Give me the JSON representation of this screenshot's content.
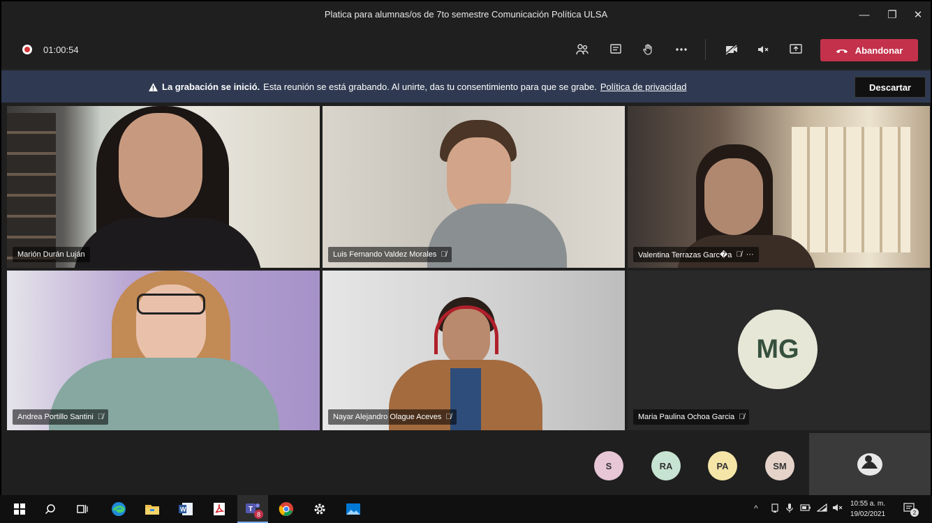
{
  "window": {
    "title": "Platica para alumnas/os de 7to semestre Comunicación Política ULSA",
    "minimize_glyph": "—",
    "maximize_glyph": "❐",
    "close_glyph": "✕"
  },
  "meeting": {
    "elapsed": "01:00:54",
    "leave_label": "Abandonar"
  },
  "banner": {
    "bold_text": "La grabación se inició.",
    "text": "Esta reunión se está grabando. Al unirte, das tu consentimiento para que se grabe.",
    "link_text": "Política de privacidad",
    "dismiss_label": "Descartar"
  },
  "tiles": [
    {
      "name": "Marión Durán Luján",
      "muted": false
    },
    {
      "name": "Luis Fernando Valdez Morales",
      "muted": true
    },
    {
      "name": "Valentina Terrazas Garc�a",
      "muted": true,
      "more": "···"
    },
    {
      "name": "Andrea Portillo Santini",
      "muted": true
    },
    {
      "name": "Nayar Alejandro Olague Aceves",
      "muted": true
    },
    {
      "name": "Maria Paulina Ochoa Garcia",
      "muted": true,
      "initials": "MG"
    }
  ],
  "overflow": [
    {
      "initials": "S",
      "color": "#e7c6d6"
    },
    {
      "initials": "RA",
      "color": "#c7e3d2"
    },
    {
      "initials": "PA",
      "color": "#f5e6a8"
    },
    {
      "initials": "SM",
      "color": "#e5d3c9"
    }
  ],
  "icons": {
    "mute": "🎤̸",
    "more_tray": "⋯"
  },
  "taskbar": {
    "time": "10:55 a. m.",
    "date": "19/02/2021",
    "teams_badge": "8",
    "notifications_badge": "2",
    "tray_chevron": "^"
  },
  "colors": {
    "leave": "#c4314b",
    "banner": "#2f3a52",
    "record": "#d13438"
  }
}
